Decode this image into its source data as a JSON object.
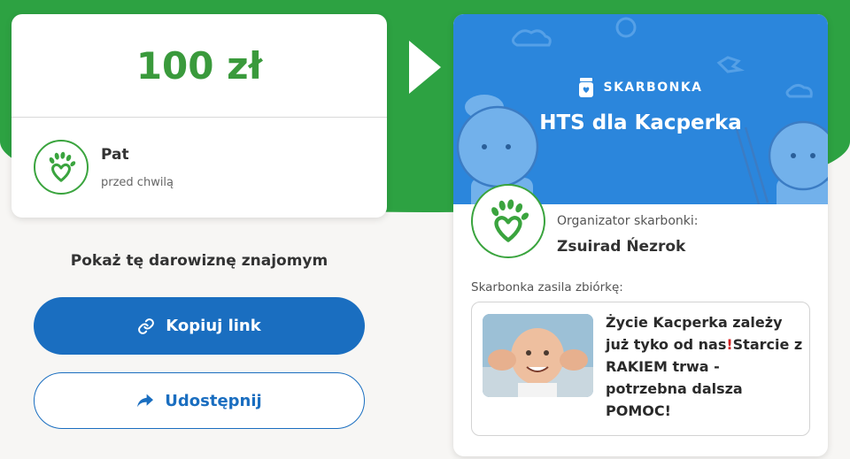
{
  "donation": {
    "amount": "100 zł",
    "donor_name": "Pat",
    "time": "przed chwilą"
  },
  "share": {
    "title": "Pokaż tę darowiznę znajomym",
    "copy_label": "Kopiuj link",
    "share_label": "Udostępnij"
  },
  "fund": {
    "brand": "SKARBONKA",
    "title": "HTS dla Kacperka",
    "organizer_label": "Organizator skarbonki:",
    "organizer_name": "Zsuirad Ńezrok",
    "supports_label": "Skarbonka zasila zbiórkę:",
    "campaign_title_a": "Życie Kacperka zależy już tyko od nas",
    "campaign_title_excl": "!",
    "campaign_title_b": "Starcie z RAKIEM trwa - potrzebna dalsza POMOC!"
  },
  "colors": {
    "brand_green": "#2da242",
    "amount_green": "#3a9a3c",
    "primary_blue": "#1a6ec0",
    "header_blue": "#2b86dc"
  },
  "icons": {
    "logo": "heart-hand-logo-icon",
    "copy": "link-icon",
    "share": "share-arrow-icon",
    "brand": "piggy-jar-icon"
  }
}
